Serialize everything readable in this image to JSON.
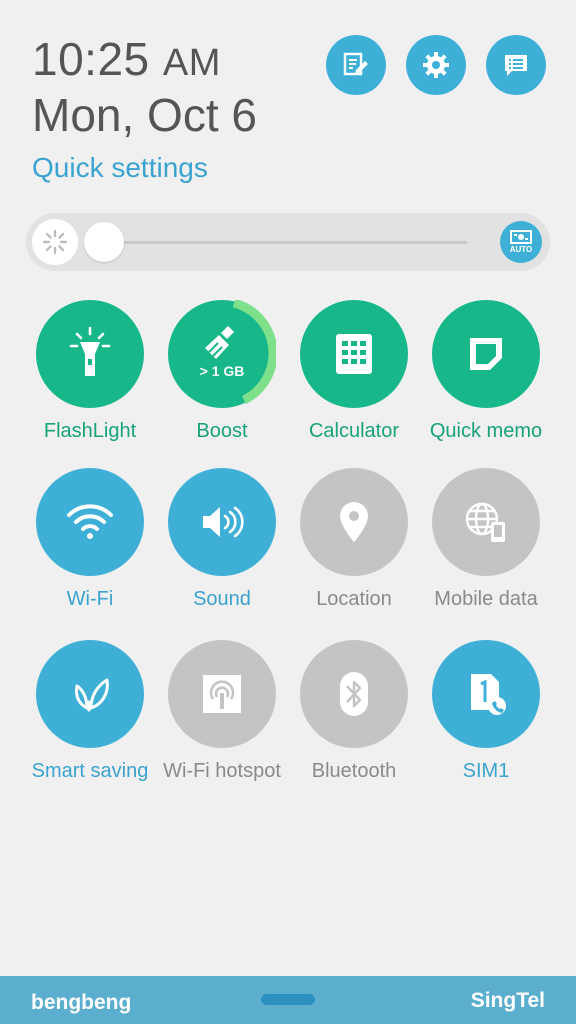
{
  "header": {
    "time": "10:25",
    "ampm": "AM",
    "date": "Mon, Oct 6",
    "quick_settings_label": "Quick settings"
  },
  "top_actions": [
    {
      "icon": "edit-icon"
    },
    {
      "icon": "gear-icon"
    },
    {
      "icon": "notifications-icon"
    }
  ],
  "brightness": {
    "level": 0.0,
    "auto_label": "AUTO"
  },
  "tiles": {
    "flashlight": {
      "label": "FlashLight",
      "state": "on"
    },
    "boost": {
      "label": "Boost",
      "badge": "> 1 GB",
      "state": "on"
    },
    "calculator": {
      "label": "Calculator",
      "state": "on"
    },
    "quick_memo": {
      "label": "Quick memo",
      "state": "on"
    },
    "wifi": {
      "label": "Wi-Fi",
      "state": "on"
    },
    "sound": {
      "label": "Sound",
      "state": "on"
    },
    "location": {
      "label": "Location",
      "state": "off"
    },
    "mobile_data": {
      "label": "Mobile data",
      "state": "off"
    },
    "smart_saving": {
      "label": "Smart saving",
      "state": "on"
    },
    "hotspot": {
      "label": "Wi-Fi hotspot",
      "state": "off"
    },
    "bluetooth": {
      "label": "Bluetooth",
      "state": "off"
    },
    "sim1": {
      "label": "SIM1",
      "state": "on"
    }
  },
  "colors": {
    "green_tile": "#18b78a",
    "blue_tile": "#3eb0d8",
    "gray_tile": "#c4c4c4",
    "bottom_bar": "#5caecf"
  },
  "footer": {
    "left": "bengbeng",
    "right": "SingTel"
  }
}
